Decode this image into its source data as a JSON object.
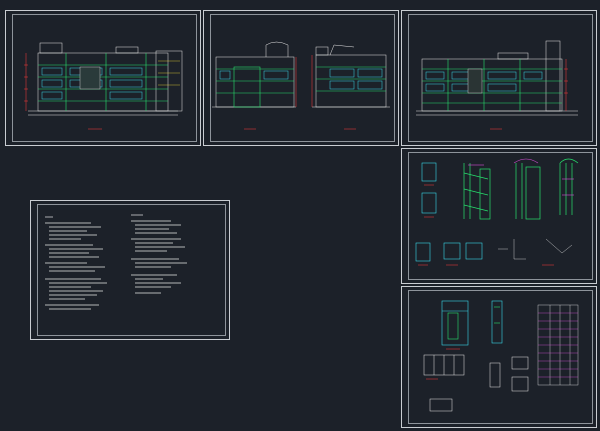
{
  "canvas": {
    "background": "#1c2129",
    "frame_color": "#c9cdd2"
  },
  "colors": {
    "line_white": "#e8e8e8",
    "line_green": "#27e06d",
    "line_cyan": "#38d6e6",
    "line_yellow": "#f2e035",
    "line_red": "#ff3b3b",
    "line_magenta": "#d84fd8",
    "line_blue": "#4c7cff"
  },
  "sheets": [
    {
      "id": "elevation-1",
      "content": "facade-elevation",
      "caption": ""
    },
    {
      "id": "elevation-2",
      "content": "side-and-end-elevations",
      "caption": ""
    },
    {
      "id": "elevation-3",
      "content": "facade-elevation",
      "caption": ""
    },
    {
      "id": "design-notes",
      "content": "general-notes",
      "caption": ""
    },
    {
      "id": "wall-sections",
      "content": "wall-section-details",
      "caption": ""
    },
    {
      "id": "window-schedule",
      "content": "door-window-schedule",
      "caption": ""
    }
  ]
}
